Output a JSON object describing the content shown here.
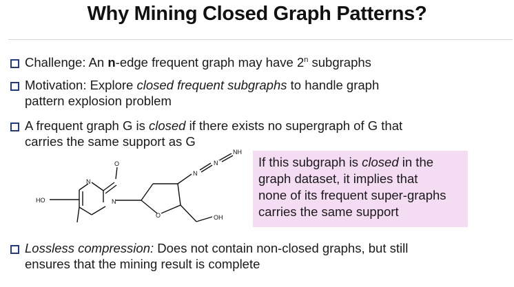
{
  "title": "Why Mining Closed Graph Patterns?",
  "bullets": {
    "b1": {
      "prefix": "Challenge: An ",
      "bold": "n",
      "mid": "-edge frequent graph may have 2",
      "sup": "n",
      "suffix": " subgraphs"
    },
    "b2": {
      "prefix": "Motivation:  Explore ",
      "italic": "closed frequent subgraphs",
      "suffix": " to handle graph",
      "line2": "pattern explosion problem"
    },
    "b3": {
      "prefix": "A frequent graph G is ",
      "italic": "closed",
      "suffix": " if there exists no supergraph of G that",
      "line2": "carries the same support as G"
    },
    "b4": {
      "italic": "Lossless compression:",
      "suffix": " Does not contain non-closed graphs, but still",
      "line2": "ensures that the mining result is complete"
    }
  },
  "callout": {
    "l1_prefix": "If this subgraph is ",
    "l1_italic": "closed",
    "l1_suffix": " in the",
    "l2": "graph dataset, it implies that",
    "l3": "none of its frequent super-graphs",
    "l4": "carries the same support"
  },
  "molecule": {
    "atoms": {
      "o_top": "O",
      "n_ring_top": "N",
      "n_ring": "N",
      "ho": "HO",
      "o_ring": "O",
      "oh": "OH",
      "n1": "N",
      "n2": "N",
      "n2_charge": "+",
      "nh": "NH"
    }
  },
  "colors": {
    "checkbox": "#1f3a93",
    "callout_bg": "#f4dcf3"
  }
}
